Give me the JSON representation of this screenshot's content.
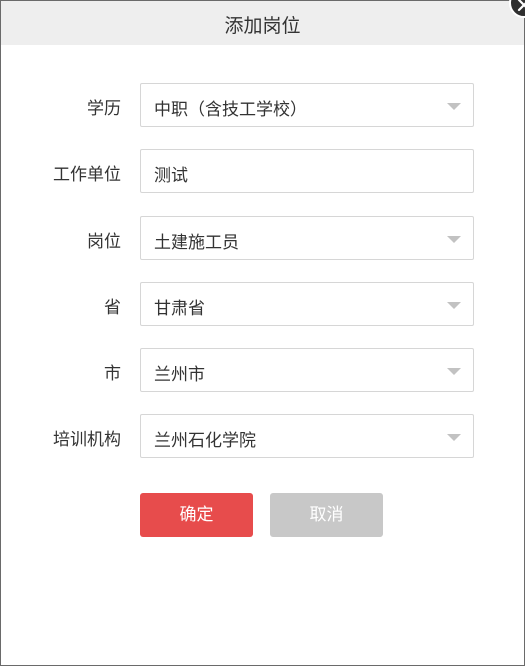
{
  "dialog": {
    "title": "添加岗位",
    "close_icon": "close-icon"
  },
  "form": {
    "education": {
      "label": "学历",
      "value": "中职（含技工学校）",
      "icon": "chevron-down-icon"
    },
    "work_unit": {
      "label": "工作单位",
      "value": "测试"
    },
    "position": {
      "label": "岗位",
      "value": "土建施工员",
      "icon": "chevron-down-icon"
    },
    "province": {
      "label": "省",
      "value": "甘肃省",
      "icon": "chevron-down-icon"
    },
    "city": {
      "label": "市",
      "value": "兰州市",
      "icon": "chevron-down-icon"
    },
    "training_org": {
      "label": "培训机构",
      "value": "兰州石化学院",
      "icon": "chevron-down-icon"
    }
  },
  "buttons": {
    "confirm_label": "确定",
    "cancel_label": "取消"
  },
  "colors": {
    "confirm": "#e74c4c",
    "cancel": "#c8c8c8",
    "titlebar": "#eeeeee"
  }
}
